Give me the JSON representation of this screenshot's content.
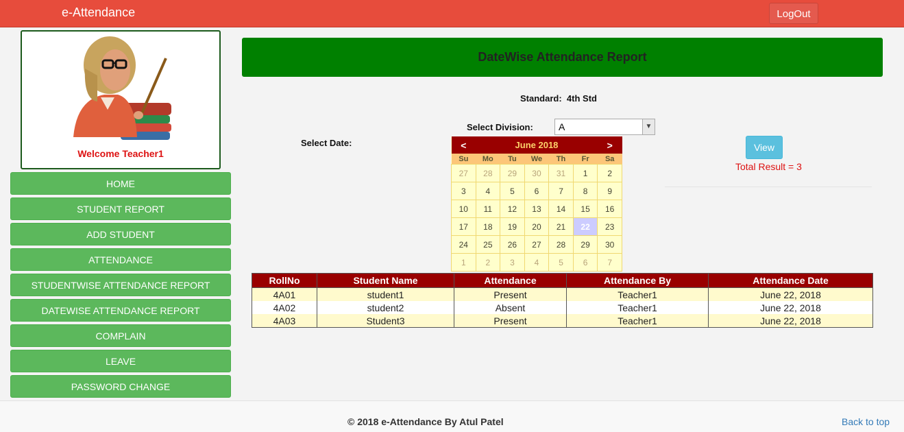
{
  "header": {
    "brand": "e-Attendance",
    "logout_label": "LogOut"
  },
  "profile": {
    "welcome": "Welcome Teacher1"
  },
  "nav": [
    "HOME",
    "STUDENT REPORT",
    "ADD STUDENT",
    "ATTENDANCE",
    "STUDENTWISE ATTENDANCE REPORT",
    "DATEWISE ATTENDANCE REPORT",
    "COMPLAIN",
    "LEAVE",
    "PASSWORD CHANGE"
  ],
  "page": {
    "title": "DateWise Attendance Report",
    "standard_label": "Standard:",
    "standard_value": "4th Std",
    "division_label": "Select Division:",
    "division_value": "A",
    "date_label": "Select Date:",
    "view_label": "View",
    "total_result": "Total Result = 3"
  },
  "calendar": {
    "prev": "<",
    "next": ">",
    "month": "June 2018",
    "days": [
      "Su",
      "Mo",
      "Tu",
      "We",
      "Th",
      "Fr",
      "Sa"
    ],
    "selected": "22",
    "weeks": [
      [
        [
          "27",
          1
        ],
        [
          "28",
          1
        ],
        [
          "29",
          1
        ],
        [
          "30",
          1
        ],
        [
          "31",
          1
        ],
        [
          "1",
          0
        ],
        [
          "2",
          0
        ]
      ],
      [
        [
          "3",
          0
        ],
        [
          "4",
          0
        ],
        [
          "5",
          0
        ],
        [
          "6",
          0
        ],
        [
          "7",
          0
        ],
        [
          "8",
          0
        ],
        [
          "9",
          0
        ]
      ],
      [
        [
          "10",
          0
        ],
        [
          "11",
          0
        ],
        [
          "12",
          0
        ],
        [
          "13",
          0
        ],
        [
          "14",
          0
        ],
        [
          "15",
          0
        ],
        [
          "16",
          0
        ]
      ],
      [
        [
          "17",
          0
        ],
        [
          "18",
          0
        ],
        [
          "19",
          0
        ],
        [
          "20",
          0
        ],
        [
          "21",
          0
        ],
        [
          "22",
          0
        ],
        [
          "23",
          0
        ]
      ],
      [
        [
          "24",
          0
        ],
        [
          "25",
          0
        ],
        [
          "26",
          0
        ],
        [
          "27",
          0
        ],
        [
          "28",
          0
        ],
        [
          "29",
          0
        ],
        [
          "30",
          0
        ]
      ],
      [
        [
          "1",
          1
        ],
        [
          "2",
          1
        ],
        [
          "3",
          1
        ],
        [
          "4",
          1
        ],
        [
          "5",
          1
        ],
        [
          "6",
          1
        ],
        [
          "7",
          1
        ]
      ]
    ]
  },
  "table": {
    "headers": [
      "RollNo",
      "Student Name",
      "Attendance",
      "Attendance By",
      "Attendance Date"
    ],
    "rows": [
      [
        "4A01",
        "student1",
        "Present",
        "Teacher1",
        "June 22, 2018"
      ],
      [
        "4A02",
        "student2",
        "Absent",
        "Teacher1",
        "June 22, 2018"
      ],
      [
        "4A03",
        "Student3",
        "Present",
        "Teacher1",
        "June 22, 2018"
      ]
    ]
  },
  "footer": {
    "copyright": "© 2018 e-Attendance By Atul Patel",
    "back_to_top": "Back to top"
  }
}
